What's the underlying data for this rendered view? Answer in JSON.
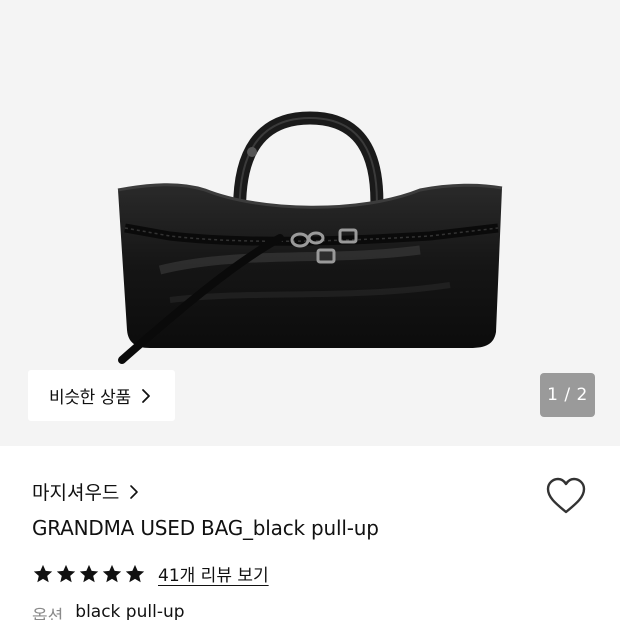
{
  "similar": {
    "label": "비슷한 상품"
  },
  "gallery": {
    "counter": "1 / 2",
    "current": 1,
    "total": 2
  },
  "brand": {
    "name": "마지셔우드"
  },
  "product": {
    "title": "GRANDMA USED BAG_black pull-up"
  },
  "rating": {
    "stars": 5,
    "reviews_link": "41개 리뷰 보기"
  },
  "option": {
    "label": "옵션",
    "value": "black pull-up"
  },
  "icons": {
    "chevron": "chevron-right-icon",
    "heart": "heart-outline-icon",
    "star": "star-filled-icon"
  },
  "colors": {
    "hero_bg": "#f4f4f4",
    "counter_bg": "#808080",
    "text": "#111111",
    "muted": "#8a8a8a"
  }
}
